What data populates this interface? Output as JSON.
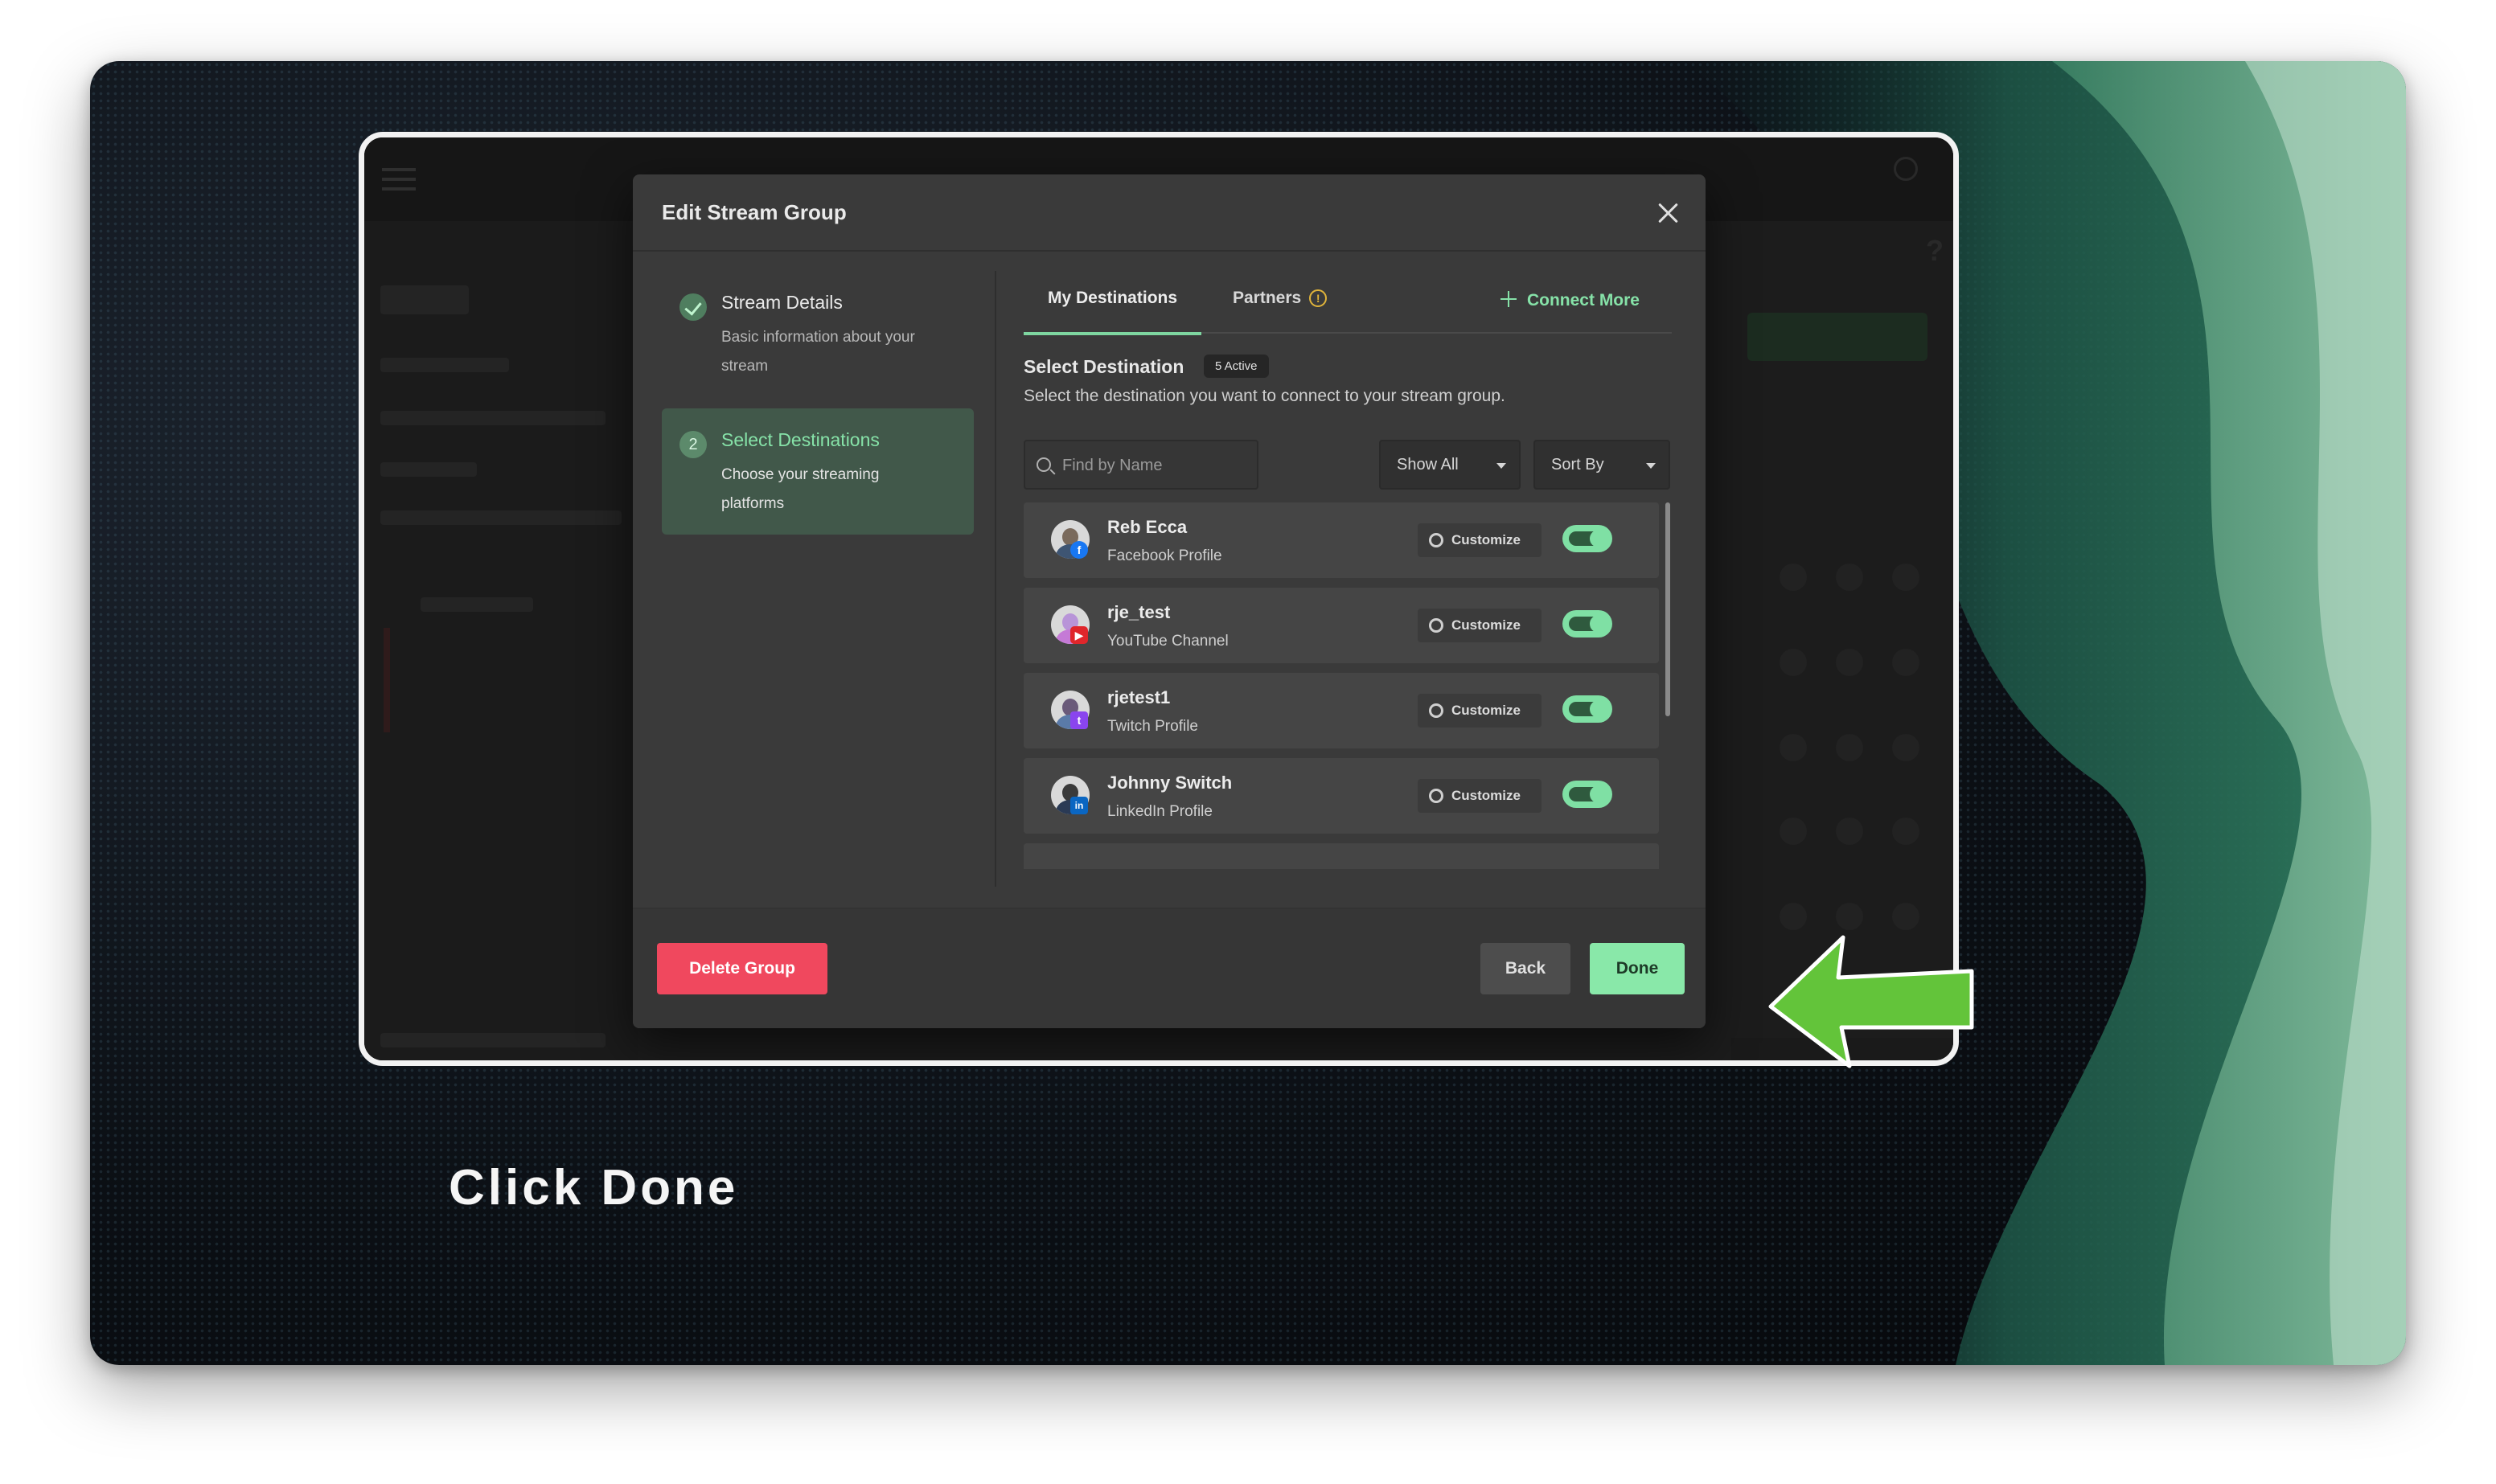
{
  "modal": {
    "title": "Edit Stream Group",
    "steps": [
      {
        "title": "Stream Details",
        "description": "Basic information about your stream",
        "number": "1",
        "state": "done"
      },
      {
        "title": "Select Destinations",
        "description": "Choose your streaming platforms",
        "number": "2",
        "state": "active"
      }
    ],
    "tabs": {
      "mine": "My Destinations",
      "partners": "Partners",
      "connect_more": "Connect More"
    },
    "select_title": "Select Destination",
    "active_badge": "5 Active",
    "select_subtitle": "Select the destination you want to connect to your stream group.",
    "search_placeholder": "Find by Name",
    "filters": {
      "show": "Show All",
      "sort": "Sort By"
    },
    "destinations": [
      {
        "name": "Reb Ecca",
        "type": "Facebook Profile",
        "platform": "facebook-icon",
        "customize": "Customize",
        "enabled": true
      },
      {
        "name": "rje_test",
        "type": "YouTube Channel",
        "platform": "youtube-icon",
        "customize": "Customize",
        "enabled": true
      },
      {
        "name": "rjetest1",
        "type": "Twitch Profile",
        "platform": "twitch-icon",
        "customize": "Customize",
        "enabled": true
      },
      {
        "name": "Johnny Switch",
        "type": "LinkedIn Profile",
        "platform": "linkedin-icon",
        "customize": "Customize",
        "enabled": true
      }
    ],
    "buttons": {
      "delete": "Delete Group",
      "back": "Back",
      "done": "Done"
    }
  },
  "caption": "Click Done",
  "colors": {
    "accent": "#86e2a8",
    "danger": "#f0485e",
    "done": "#89e8a9",
    "arrow": "#63c43a"
  }
}
